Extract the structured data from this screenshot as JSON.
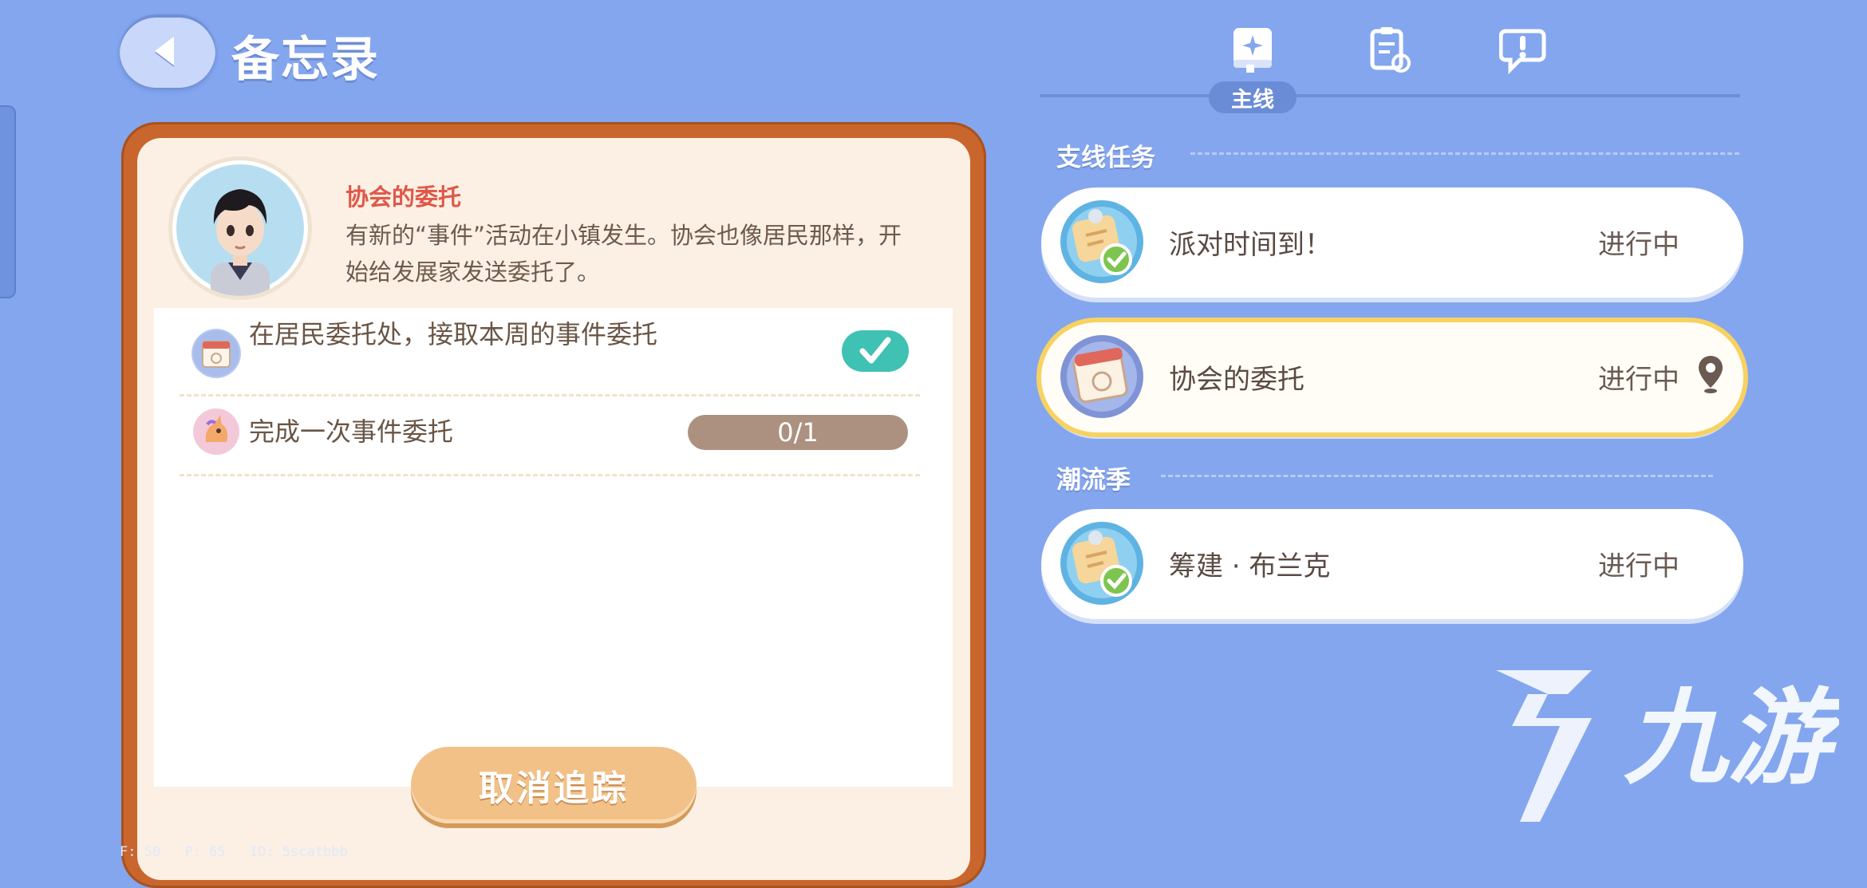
{
  "header": {
    "title": "备忘录",
    "back_icon": "back-arrow-icon"
  },
  "tabs": [
    {
      "icon": "sparkle-book-icon",
      "label": "主线",
      "active": true
    },
    {
      "icon": "clipboard-refresh-icon",
      "label": "",
      "active": false
    },
    {
      "icon": "chat-exclamation-icon",
      "label": "",
      "active": false
    }
  ],
  "detail": {
    "name": "协会的委托",
    "description": "有新的“事件”活动在小镇发生。协会也像居民那样，开始给发展家发送委托了。",
    "objectives": [
      {
        "text": "在居民委托处，接取本周的事件委托",
        "status": "complete",
        "icon": "calendar-badge-icon"
      },
      {
        "text": "完成一次事件委托",
        "progress": "0/1",
        "progress_fraction": 0,
        "icon": "unicorn-badge-icon"
      }
    ],
    "cancel_button": "取消追踪"
  },
  "sections": [
    {
      "title": "支线任务",
      "quests": [
        {
          "name": "派对时间到！",
          "status": "进行中",
          "icon": "scroll-check-icon",
          "selected": false
        },
        {
          "name": "协会的委托",
          "status": "进行中",
          "icon": "calendar-badge-icon",
          "selected": true,
          "tracked": true
        }
      ]
    },
    {
      "title": "潮流季",
      "quests": [
        {
          "name": "筹建 · 布兰克",
          "status": "进行中",
          "icon": "scroll-check-icon",
          "selected": false
        }
      ]
    }
  ],
  "watermark": {
    "text": "九游"
  },
  "debug": {
    "f": "F: 50",
    "p": "P: 65",
    "id": "ID: 5scatbbb"
  },
  "colors": {
    "background": "#84a6ee",
    "card_border": "#c9662e",
    "accent_red": "#e0574a",
    "selected_outline": "#f7d262",
    "check_green": "#3fc1b4"
  }
}
